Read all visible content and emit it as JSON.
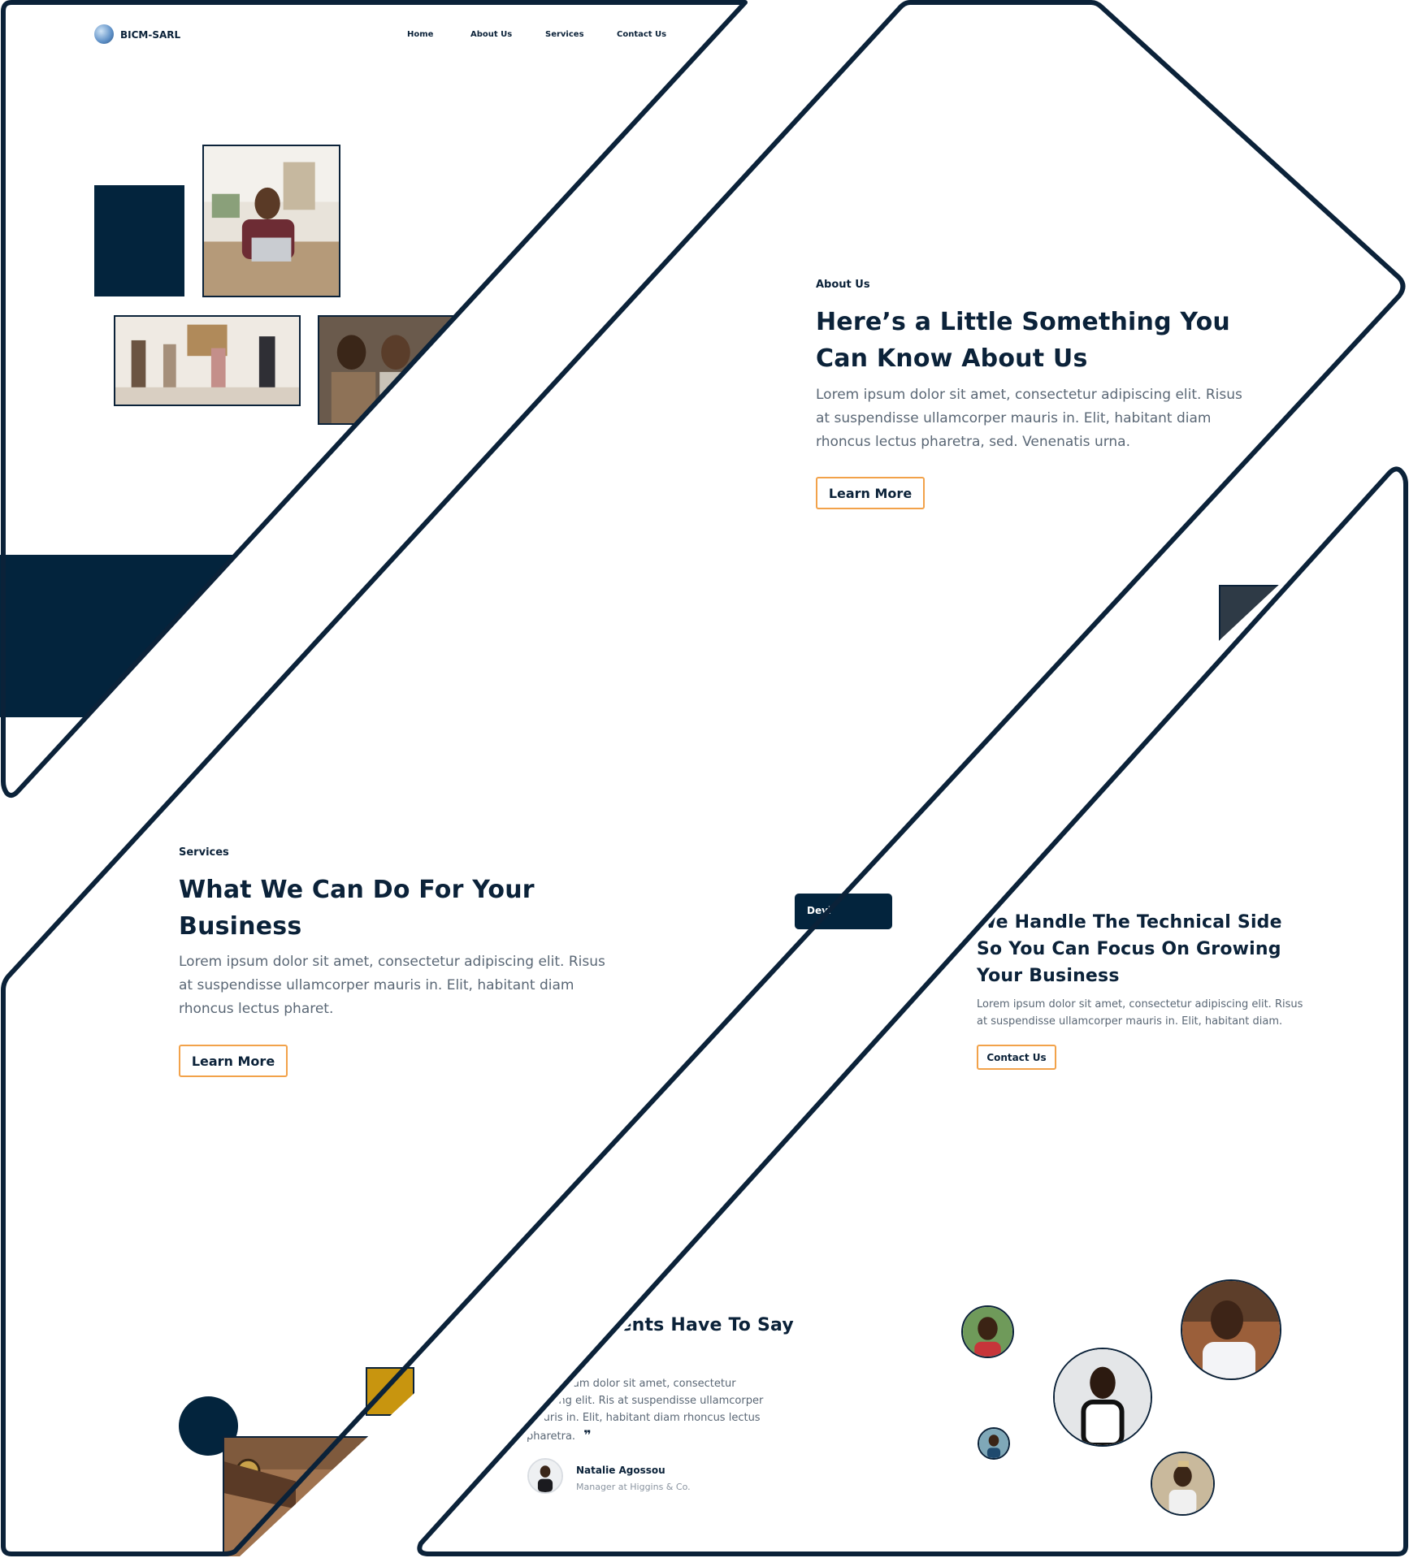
{
  "brand": {
    "name": "BICM-SARL"
  },
  "nav": {
    "items": [
      {
        "label": "Home"
      },
      {
        "label": "About Us"
      },
      {
        "label": "Services"
      },
      {
        "label": "Contact Us"
      }
    ]
  },
  "about": {
    "eyebrow": "About Us",
    "title_line1": "Here’s a Little Something You",
    "title_line2": "Can Know About Us",
    "body_line1": "Lorem ipsum dolor sit amet, consectetur adipiscing elit. Risus",
    "body_line2": "at suspendisse ullamcorper mauris in. Elit, habitant diam",
    "body_line3": "rhoncus lectus pharetra, sed. Venenatis urna.",
    "cta": "Learn More"
  },
  "services": {
    "eyebrow": "Services",
    "title_line1": "What We Can Do For Your",
    "title_line2": "Business",
    "body_line1": "Lorem ipsum dolor sit amet, consectetur adipiscing elit. Risus",
    "body_line2": "at suspendisse ullamcorper mauris in. Elit, habitant diam",
    "body_line3": "rhoncus lectus pharet.",
    "cta": "Learn More",
    "card_label": "Devi"
  },
  "technical": {
    "title_line1": "We Handle The Technical Side",
    "title_line2": "So You Can Focus On Growing",
    "title_line3": "Your Business",
    "body_line1": "Lorem ipsum dolor sit amet, consectetur adipiscing elit. Risus",
    "body_line2": "at suspendisse ullamcorper mauris in. Elit, habitant diam.",
    "cta": "Contact Us"
  },
  "testimonials": {
    "title": "lients Have To Say",
    "quote_line1": "ipsum dolor sit amet, consectetur",
    "quote_line2": "piscing elit. Ris at suspendisse ullamcorper",
    "quote_line3": "mauris in. Elit, habitant diam rhoncus lectus",
    "quote_line4": "pharetra.",
    "quote_mark": "❞",
    "author_name": "Natalie Agossou",
    "author_role": "Manager at Higgins & Co."
  },
  "colors": {
    "navy": "#03243d",
    "accent": "#f2a24a",
    "text": "#0b2239",
    "muted": "#5a6775"
  },
  "icons": {
    "logo": "globe-logo-icon",
    "quote": "close-quote-icon"
  }
}
